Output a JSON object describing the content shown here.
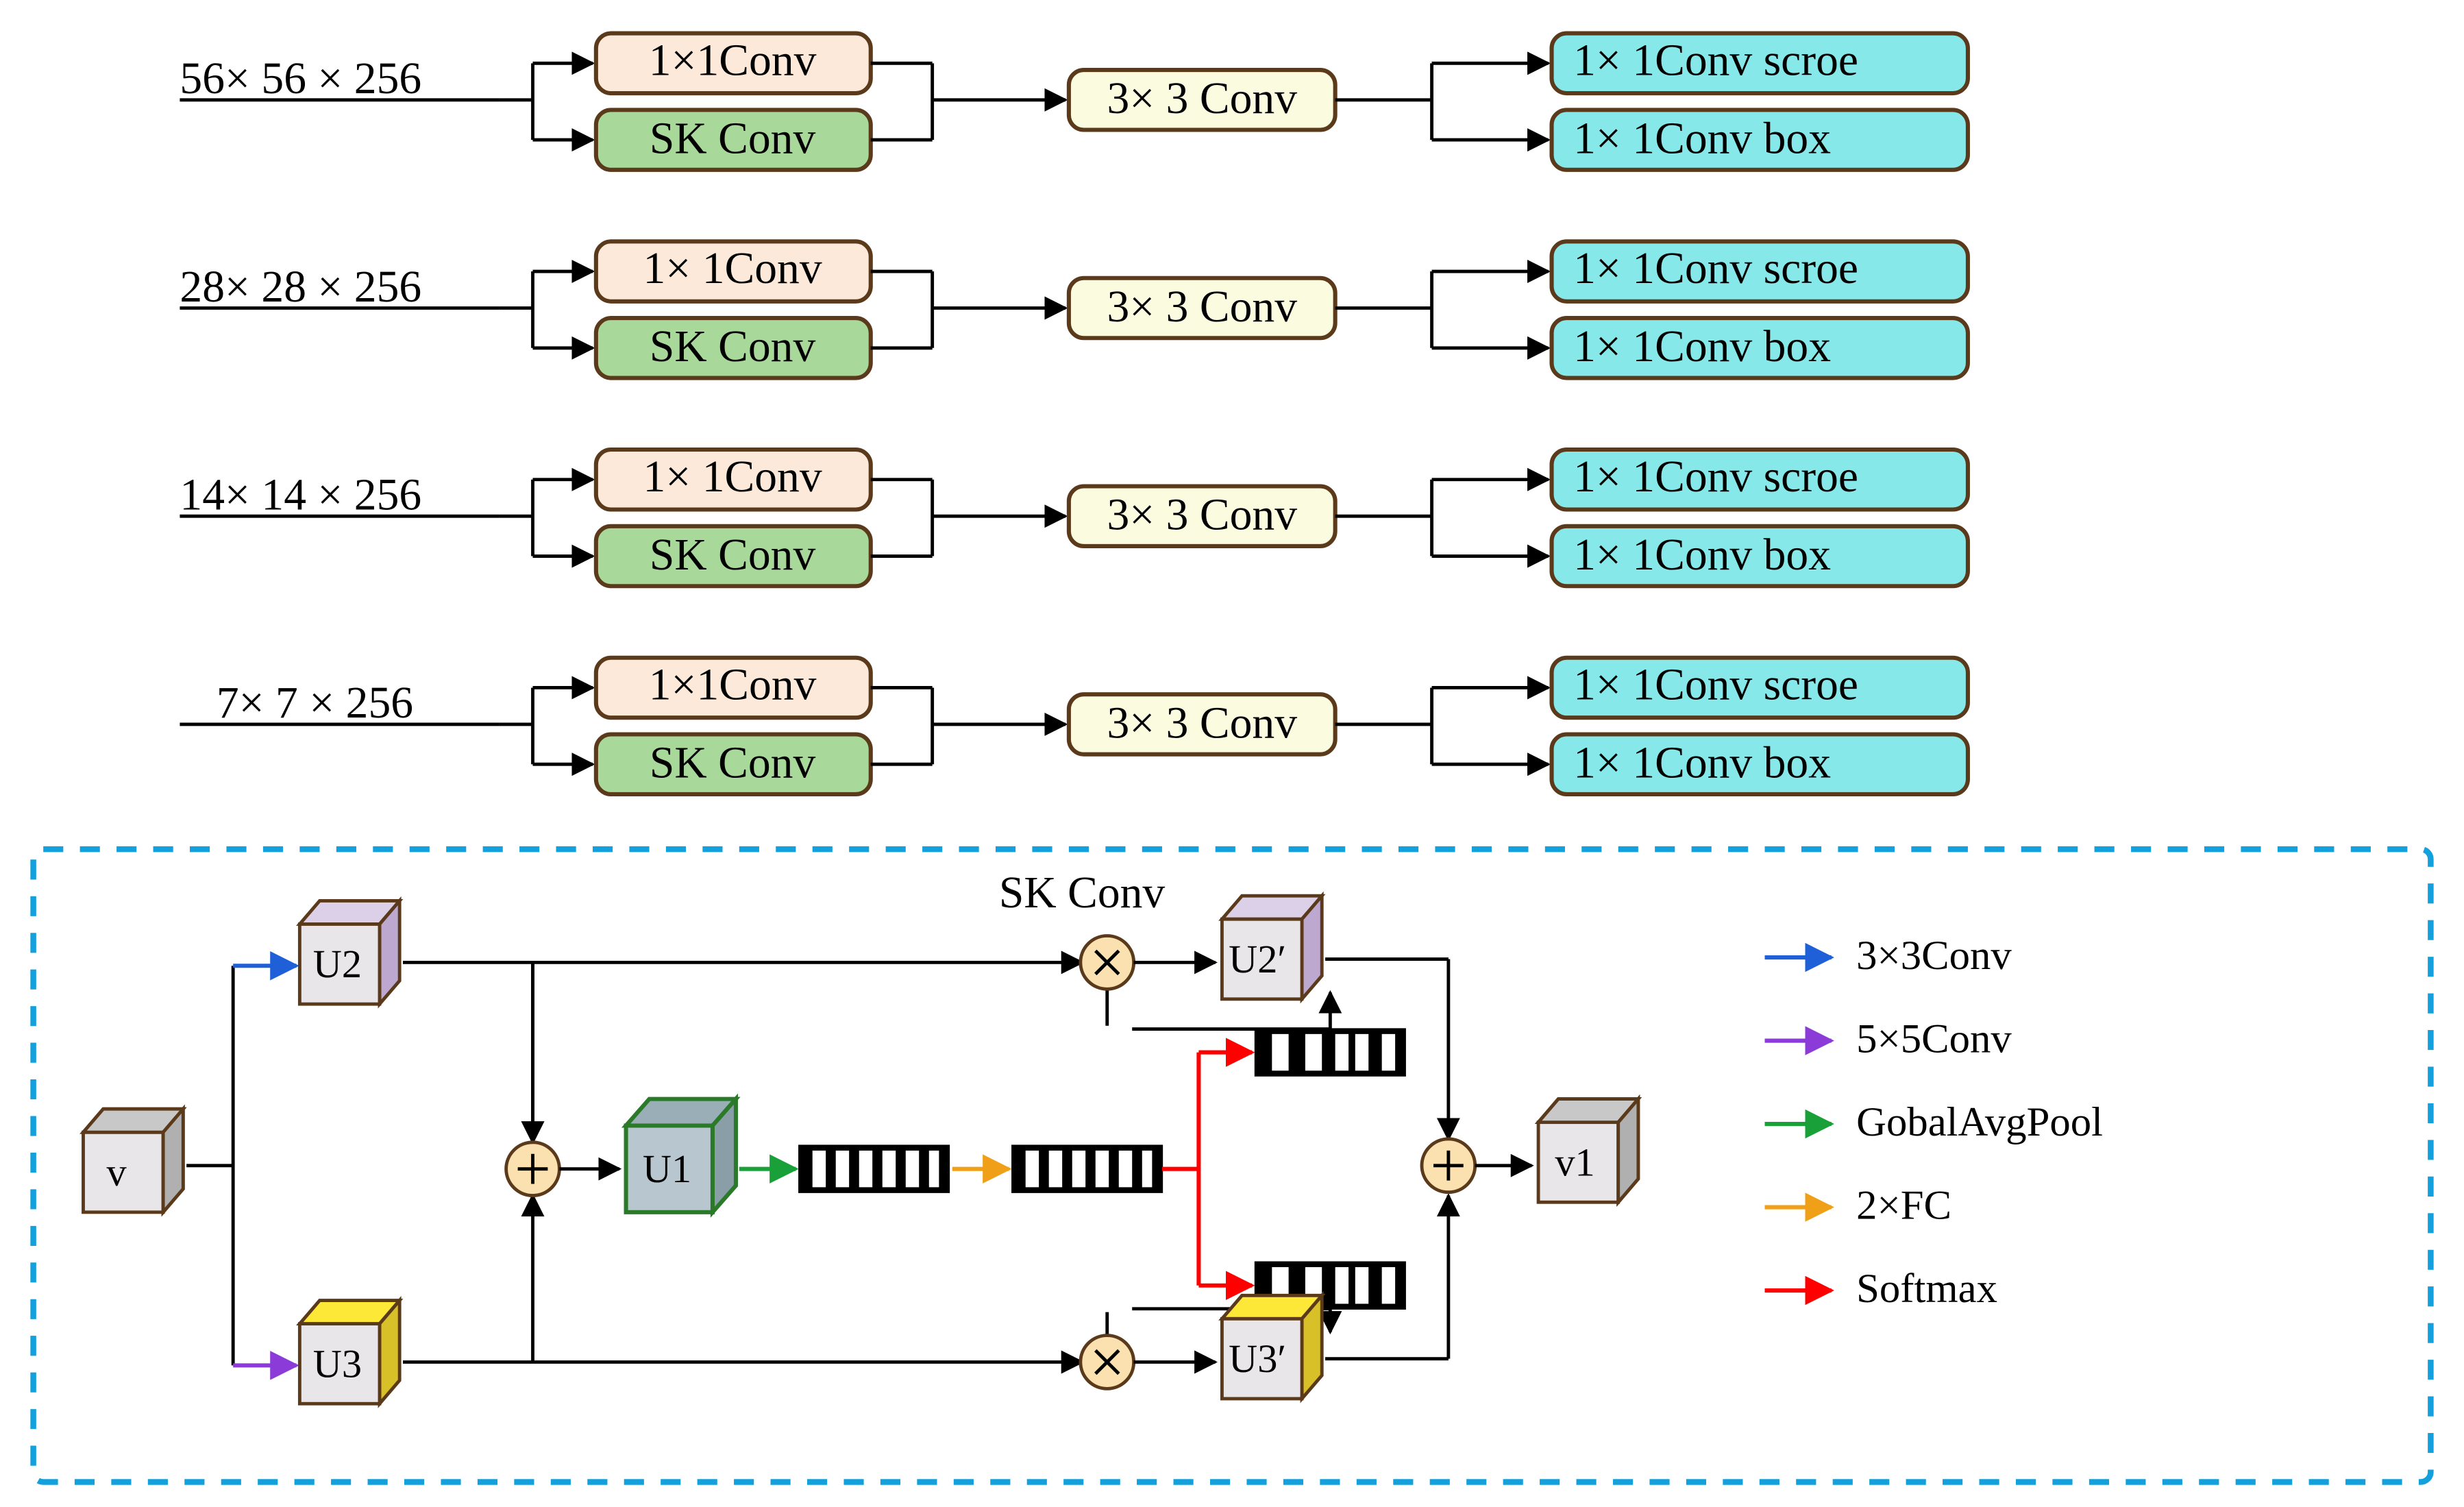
{
  "rows": [
    {
      "input": "56× 56 × 256",
      "b1": "1×1Conv",
      "b2": "SK Conv",
      "mid": "3× 3 Conv",
      "o1": "1× 1Conv  scroe",
      "o2": "1× 1Conv    box"
    },
    {
      "input": "28× 28 × 256",
      "b1": "1× 1Conv",
      "b2": "SK Conv",
      "mid": "3× 3 Conv",
      "o1": "1× 1Conv  scroe",
      "o2": "1× 1Conv    box"
    },
    {
      "input": "14× 14 × 256",
      "b1": "1× 1Conv",
      "b2": "SK Conv",
      "mid": "3× 3 Conv",
      "o1": "1× 1Conv  scroe",
      "o2": "1× 1Conv    box"
    },
    {
      "input": "7× 7 × 256",
      "b1": "1×1Conv",
      "b2": "SK Conv",
      "mid": "3× 3 Conv",
      "o1": "1× 1Conv  scroe",
      "o2": "1× 1Conv    box"
    }
  ],
  "sk": {
    "title": "SK Conv",
    "v": "v",
    "u2": "U2",
    "u3": "U3",
    "u1": "U1",
    "u2p": "U2′",
    "u3p": "U3′",
    "v1": "v1"
  },
  "legend": {
    "c33": "3×3Conv",
    "c55": "5×5Conv",
    "gap": "GobalAvgPool",
    "fc": "2×FC",
    "sm": "Softmax"
  },
  "colors": {
    "arr_blue": "#1f5fd8",
    "arr_purple": "#8a3bd8",
    "arr_green": "#1aa038",
    "arr_yellow": "#f0a018",
    "arr_red": "#ff0000"
  }
}
